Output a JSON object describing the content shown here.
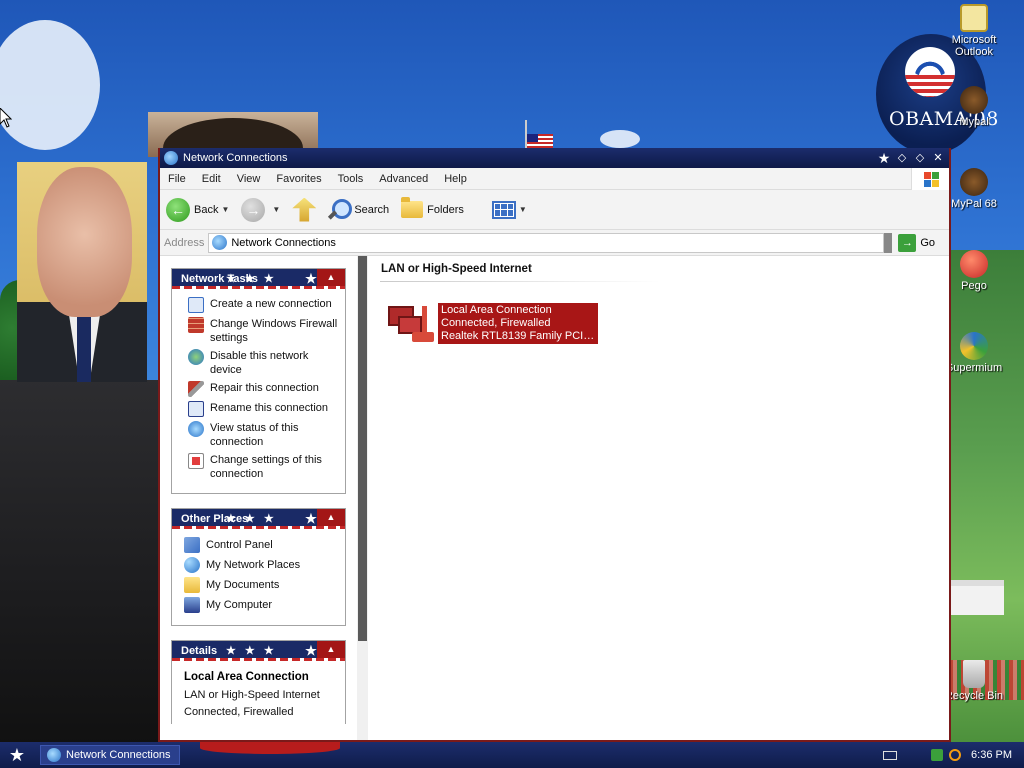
{
  "window": {
    "title": "Network Connections"
  },
  "menu": [
    "File",
    "Edit",
    "View",
    "Favorites",
    "Tools",
    "Advanced",
    "Help"
  ],
  "toolbar": {
    "back": "Back",
    "search": "Search",
    "folders": "Folders"
  },
  "address": {
    "label": "Address",
    "value": "Network Connections",
    "go": "Go"
  },
  "panels": {
    "network_tasks": {
      "title": "Network Tasks",
      "items": [
        "Create a new connection",
        "Change Windows Firewall settings",
        "Disable this network device",
        "Repair this connection",
        "Rename this connection",
        "View status of this connection",
        "Change settings of this connection"
      ]
    },
    "other_places": {
      "title": "Other Places",
      "items": [
        "Control Panel",
        "My Network Places",
        "My Documents",
        "My Computer"
      ]
    },
    "details": {
      "title": "Details",
      "name": "Local Area Connection",
      "type": "LAN or High-Speed Internet",
      "status": "Connected, Firewalled"
    }
  },
  "main": {
    "group_title": "LAN or High-Speed Internet",
    "connection": {
      "name": "Local Area Connection",
      "status": "Connected, Firewalled",
      "device": "Realtek RTL8139 Family PCI F..."
    }
  },
  "desktop_icons": [
    "Microsoft Outlook",
    "Mypal",
    "MyPal 68",
    "Pego",
    "Supermium",
    "Recycle Bin"
  ],
  "wallpaper_text": "OBAMA'08",
  "taskbar": {
    "window_button": "Network Connections",
    "clock": "6:36 PM"
  },
  "colors": {
    "titlebar": "#14235a",
    "accent_red": "#a81616",
    "panel_blue": "#1a2a66"
  }
}
